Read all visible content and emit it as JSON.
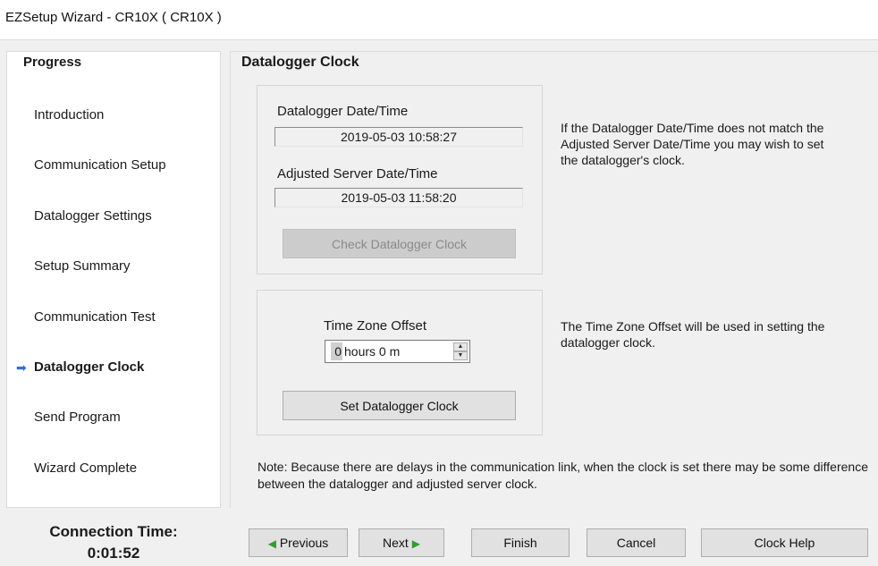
{
  "window": {
    "title": "EZSetup Wizard - CR10X ( CR10X )"
  },
  "sidebar": {
    "title": "Progress",
    "active_marker": "➡",
    "steps": [
      {
        "label": "Introduction"
      },
      {
        "label": "Communication Setup"
      },
      {
        "label": "Datalogger Settings"
      },
      {
        "label": "Setup Summary"
      },
      {
        "label": "Communication Test"
      },
      {
        "label": "Datalogger Clock"
      },
      {
        "label": "Send Program"
      },
      {
        "label": "Wizard Complete"
      }
    ],
    "active_index": 5
  },
  "connection": {
    "label": "Connection Time:",
    "value": "0:01:52"
  },
  "main": {
    "title": "Datalogger Clock",
    "clock_group": {
      "logger_label": "Datalogger Date/Time",
      "logger_value": "2019-05-03 10:58:27",
      "server_label": "Adjusted Server Date/Time",
      "server_value": "2019-05-03 11:58:20",
      "check_button": "Check Datalogger Clock"
    },
    "clock_info": "If the Datalogger Date/Time does not match the Adjusted Server Date/Time you may wish to set the datalogger's clock.",
    "tz_group": {
      "label": "Time Zone Offset",
      "hours_value": "0",
      "unit_text": "hours 0 m",
      "set_button": "Set Datalogger Clock"
    },
    "tz_info": "The Time Zone Offset will be used in setting the datalogger clock.",
    "note": "Note: Because there are delays in the communication link, when the clock is set there may be some difference between the datalogger and adjusted server clock."
  },
  "footer": {
    "previous": "Previous",
    "next": "Next",
    "finish": "Finish",
    "cancel": "Cancel",
    "help": "Clock Help"
  }
}
